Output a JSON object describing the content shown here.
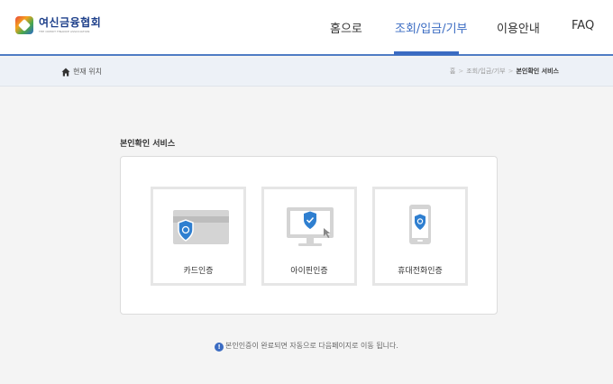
{
  "header": {
    "logo_name": "여신금융협회",
    "logo_sub": "THE CREDIT FINANCE ASSOCIATION",
    "nav": [
      {
        "label": "홈으로"
      },
      {
        "label": "조회/입금/기부",
        "active": true
      },
      {
        "label": "이용안내"
      },
      {
        "label": "FAQ"
      }
    ]
  },
  "breadcrumb": {
    "here_label": "현재 위치",
    "items": [
      "홈",
      "조회/입금/기부",
      "본인확인 서비스"
    ]
  },
  "main": {
    "section_title": "본인확인 서비스",
    "options": [
      {
        "label": "카드인증",
        "icon": "card-shield-icon"
      },
      {
        "label": "아이핀인증",
        "icon": "monitor-shield-icon"
      },
      {
        "label": "휴대전화인증",
        "icon": "phone-shield-icon"
      }
    ],
    "notice_icon": "!",
    "notice": "본인인증이 완료되면 자동으로 다음페이지로 이동 됩니다."
  },
  "colors": {
    "accent": "#3a6bc2",
    "shield": "#2f7fd0",
    "icon_gray": "#d4d4d4"
  }
}
